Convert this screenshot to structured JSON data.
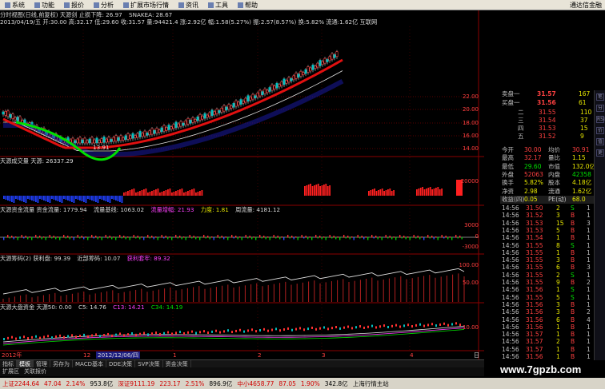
{
  "menu": {
    "items": [
      {
        "label": "系统",
        "icon": "system-icon"
      },
      {
        "label": "功能",
        "icon": "function-icon"
      },
      {
        "label": "报价",
        "icon": "quote-icon"
      },
      {
        "label": "分析",
        "icon": "analysis-icon"
      },
      {
        "label": "扩展市场行情",
        "icon": "market-icon"
      },
      {
        "label": "资讯",
        "icon": "news-icon"
      },
      {
        "label": "工具",
        "icon": "tools-icon"
      },
      {
        "label": "帮助",
        "icon": "help-icon"
      }
    ],
    "broker": "通达信金融"
  },
  "kline": {
    "title": "分时视图(日线,前复权) 天源剑 止损下降: 26.97",
    "snake": "SNAKEA: 28.67",
    "ohlc": "2013/04/19/五 开:30.00 高:32.17 低:29.60 收:31.57 量:94421.4 涨:2.92亿 幅:1.58(5.27%) 振:2.57(8.57%) 换:5.82% 流通:1.62亿 互联网",
    "price_ticks": [
      "22.00",
      "20.00",
      "18.00",
      "16.00",
      "14.00"
    ],
    "low_label": "13.91"
  },
  "volume": {
    "title": "天源成交量  天源: 26337.29",
    "ticks": [
      "20000"
    ]
  },
  "capital": {
    "title": "天源资金流量  资金流量: 1779.94",
    "base": "流量基线: 1063.02",
    "increase": "流量增幅: 21.93",
    "power": "力度: 1.81",
    "week": "周流量: 4181.12",
    "ticks": [
      "3000",
      "0",
      "-3000"
    ]
  },
  "chips": {
    "title": "天源筹码(2) 获利盘: 99.39",
    "recent": "近部筹码: 10.07",
    "trapped": "获利套牢: 89.32",
    "ticks": [
      "100.00",
      "50.00"
    ]
  },
  "market": {
    "title": "天源大盘资金  天源50: 0.00",
    "c5": "C5: 14.76",
    "c13": "C13: 14.21",
    "c34": "C34: 14.19",
    "ticks": [
      "10.00"
    ]
  },
  "timeline": {
    "year": "2012年",
    "date_box": "2012/12/06/四",
    "ticks": [
      "12",
      "1",
      "2",
      "3",
      "4",
      "日"
    ]
  },
  "quote": {
    "sell_label": "卖盘一",
    "sell_price": "31.57",
    "sell_vol": "167",
    "buy_label": "买盘一",
    "buy_price": "31.56",
    "buy_vol": "61",
    "levels": [
      {
        "name": "二",
        "price": "31.55",
        "vol": "110"
      },
      {
        "name": "三",
        "price": "31.54",
        "vol": "37"
      },
      {
        "name": "四",
        "price": "31.53",
        "vol": "15"
      },
      {
        "name": "五",
        "price": "31.52",
        "vol": "9"
      }
    ],
    "stats": [
      {
        "l1": "今开",
        "v1": "30.00",
        "l2": "均价",
        "v2": "30.91"
      },
      {
        "l1": "最高",
        "v1": "32.17",
        "l2": "量比",
        "v2": "1.15"
      },
      {
        "l1": "最低",
        "v1": "29.60",
        "l2": "市值",
        "v2": "132.0亿"
      },
      {
        "l1": "外盘",
        "v1": "52063",
        "l2": "内盘",
        "v2": "42358"
      },
      {
        "l1": "换手",
        "v1": "5.82%",
        "l2": "股本",
        "v2": "4.18亿"
      },
      {
        "l1": "净资",
        "v1": "2.98",
        "l2": "流通",
        "v2": "1.62亿"
      },
      {
        "l1": "收益(四)",
        "v1": "0.05",
        "l2": "PE(动)",
        "v2": "68.0"
      }
    ],
    "ticks": [
      {
        "t": "14:56",
        "p": "31.50",
        "v": "2",
        "d": "S",
        "n": "1"
      },
      {
        "t": "14:56",
        "p": "31.52",
        "v": "3",
        "d": "B",
        "n": "1"
      },
      {
        "t": "14:56",
        "p": "31.53",
        "v": "15",
        "d": "B",
        "n": "3"
      },
      {
        "t": "14:56",
        "p": "31.53",
        "v": "5",
        "d": "B",
        "n": "1"
      },
      {
        "t": "14:56",
        "p": "31.54",
        "v": "1",
        "d": "B",
        "n": "1"
      },
      {
        "t": "14:56",
        "p": "31.55",
        "v": "8",
        "d": "S",
        "n": "1"
      },
      {
        "t": "14:56",
        "p": "31.55",
        "v": "1",
        "d": "B",
        "n": "1"
      },
      {
        "t": "14:56",
        "p": "31.55",
        "v": "3",
        "d": "B",
        "n": "1"
      },
      {
        "t": "14:56",
        "p": "31.55",
        "v": "6",
        "d": "B",
        "n": "3"
      },
      {
        "t": "14:56",
        "p": "31.55",
        "v": "2",
        "d": "S",
        "n": "1"
      },
      {
        "t": "14:56",
        "p": "31.55",
        "v": "9",
        "d": "B",
        "n": "2"
      },
      {
        "t": "14:56",
        "p": "31.56",
        "v": "1",
        "d": "S",
        "n": "1"
      },
      {
        "t": "14:56",
        "p": "31.55",
        "v": "5",
        "d": "S",
        "n": "1"
      },
      {
        "t": "14:56",
        "p": "31.56",
        "v": "3",
        "d": "B",
        "n": "1"
      },
      {
        "t": "14:56",
        "p": "31.56",
        "v": "3",
        "d": "B",
        "n": "2"
      },
      {
        "t": "14:56",
        "p": "31.56",
        "v": "6",
        "d": "B",
        "n": "4"
      },
      {
        "t": "14:56",
        "p": "31.56",
        "v": "1",
        "d": "B",
        "n": "1"
      },
      {
        "t": "14:56",
        "p": "31.57",
        "v": "1",
        "d": "B",
        "n": "1"
      },
      {
        "t": "14:56",
        "p": "31.57",
        "v": "2",
        "d": "B",
        "n": "1"
      },
      {
        "t": "14:56",
        "p": "31.57",
        "v": "1",
        "d": "B",
        "n": "1"
      },
      {
        "t": "14:56",
        "p": "31.56",
        "v": "1",
        "d": "B",
        "n": "1"
      }
    ],
    "side_buttons": [
      "笔",
      "分",
      "RSI",
      "价",
      "值",
      "更"
    ]
  },
  "tabs": [
    "指标",
    "模板",
    "管理",
    "另存为",
    "MACD基本",
    "DDE决策",
    "SVP决策",
    "资金决策"
  ],
  "subtabs": [
    "扩展区",
    "关联报价"
  ],
  "watermark": "www.7gpzb.com",
  "status": [
    {
      "text": "上证2244.64",
      "cls": "sb-red"
    },
    {
      "text": "47.04",
      "cls": "sb-red"
    },
    {
      "text": "2.14%",
      "cls": "sb-red"
    },
    {
      "text": "953.8亿",
      "cls": ""
    },
    {
      "text": "深证9111.19",
      "cls": "sb-red"
    },
    {
      "text": "223.17",
      "cls": "sb-red"
    },
    {
      "text": "2.51%",
      "cls": "sb-red"
    },
    {
      "text": "896.9亿",
      "cls": ""
    },
    {
      "text": "中小4658.77",
      "cls": "sb-red"
    },
    {
      "text": "87.05",
      "cls": "sb-red"
    },
    {
      "text": "1.90%",
      "cls": "sb-red"
    },
    {
      "text": "342.8亿",
      "cls": ""
    },
    {
      "text": "上海行情主站",
      "cls": ""
    }
  ]
}
